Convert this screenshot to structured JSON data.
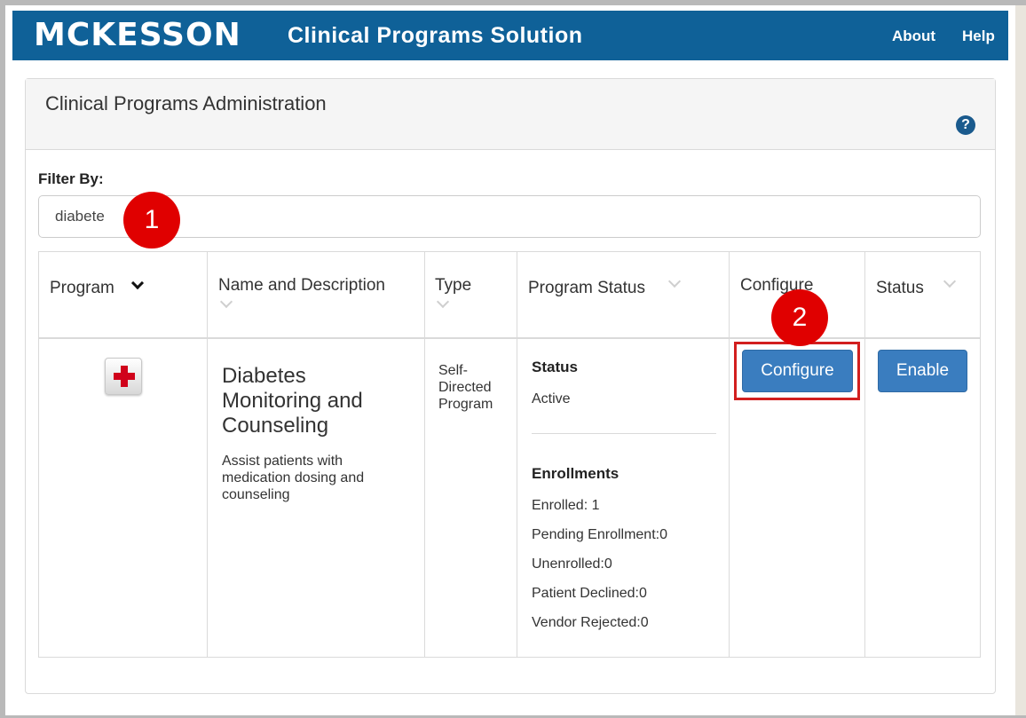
{
  "header": {
    "logo": "MCKESSON",
    "app_title": "Clinical Programs Solution",
    "nav": {
      "about": "About",
      "help": "Help"
    }
  },
  "panel": {
    "title": "Clinical Programs Administration",
    "help_icon": "question-circle-icon"
  },
  "filter": {
    "label": "Filter By:",
    "value": "diabete"
  },
  "annotations": {
    "step1": "1",
    "step2": "2",
    "highlight_color": "#d21f1f"
  },
  "table": {
    "columns": [
      {
        "label": "Program"
      },
      {
        "label": "Name and Description"
      },
      {
        "label": "Type"
      },
      {
        "label": "Program Status"
      },
      {
        "label": "Configure"
      },
      {
        "label": "Status"
      }
    ],
    "rows": [
      {
        "icon": "medical-cross-icon",
        "name": "Diabetes Monitoring and Counseling",
        "description": "Assist patients with medication dosing and counseling",
        "type": "Self-Directed Program",
        "status_label": "Status",
        "status_value": "Active",
        "enrollments_label": "Enrollments",
        "enrolled": "Enrolled: 1",
        "pending": "Pending Enrollment:0",
        "unenrolled": "Unenrolled:0",
        "declined": "Patient Declined:0",
        "rejected": "Vendor Rejected:0",
        "configure_button": "Configure",
        "enable_button": "Enable"
      }
    ]
  },
  "colors": {
    "header_bg": "#0f6198",
    "button_bg": "#3a7dbf",
    "badge_red": "#e00000"
  }
}
